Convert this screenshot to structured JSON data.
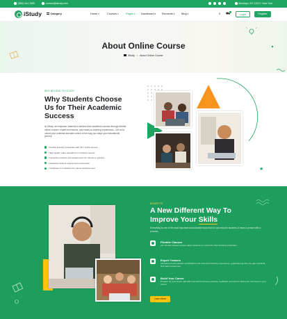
{
  "topbar": {
    "phone": "(555) 444-7890",
    "email": "contact@istudy.com",
    "address": "Brooklyn, NY 11217, New York"
  },
  "header": {
    "logo": "iStudy",
    "category": "Category",
    "nav": [
      {
        "label": "Home",
        "active": false
      },
      {
        "label": "Courses",
        "active": false
      },
      {
        "label": "Pages",
        "active": true
      },
      {
        "label": "Dashboard",
        "active": false
      },
      {
        "label": "Elements",
        "active": false
      },
      {
        "label": "Blog",
        "active": false
      }
    ],
    "login": "Login",
    "register": "Register"
  },
  "hero": {
    "title": "About Online Course",
    "breadcrumb_home": "iStudy",
    "breadcrumb_current": "About Online Course"
  },
  "why": {
    "tag": "WHY BELONG TO ISTUDY",
    "title": "Why Students Choose Us for Their Academic Success",
    "desc": "At iStudy, we empower students to achieve their academic success through flexible online courses, expert-led lessons, and hands-on learning experiences. Join us to unlock your potential and take control of the way you shape your educational journey.",
    "items": [
      "Flexible learning schedules with 24/7 online access",
      "High-quality video tutorials from industry experts",
      "Interactive practice and assignments for hands-on practice",
      "Dedicated student support and mentorship",
      "Certificate of completion for career advancement"
    ]
  },
  "improve": {
    "tag": "BENEFITS",
    "title_before": "A New Different Way To Improve Your ",
    "title_highlight": "Skills",
    "desc": "Everything is one of the most important and adorable tools that we can help the students, it helps a person with a process.",
    "features": [
      {
        "title": "Flexible Classes",
        "desc": "Our flexible classes feature allow students to customize their learning schedules."
      },
      {
        "title": "Expert Trainers",
        "desc": "All trainers hold relevant certifications and real-world industry experience, guaranteeing that you gain practical, first-hand experience."
      },
      {
        "title": "Build Your Career",
        "desc": "Prepare for your dream job with real-world interview practice, feedback, and tips for taking the next step in your career."
      }
    ],
    "button": "Learn More"
  },
  "colors": {
    "primary": "#1fa461",
    "green_section": "#1e9e5c",
    "accent_orange": "#f7941d",
    "accent_yellow": "#ffc20e"
  }
}
